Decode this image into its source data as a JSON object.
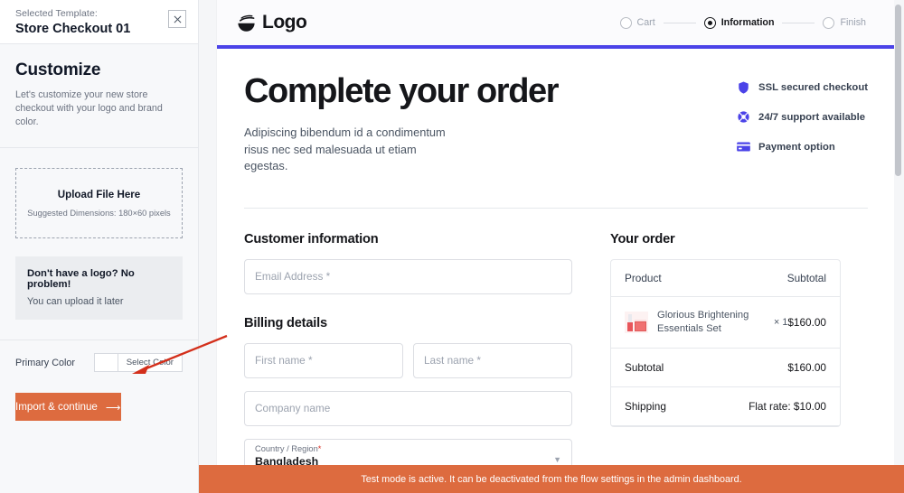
{
  "sidebar": {
    "selected_template_label": "Selected Template:",
    "template_name": "Store Checkout 01",
    "close_icon": "close-icon",
    "customize_title": "Customize",
    "customize_desc": "Let's customize your new store checkout with your logo and brand color.",
    "upload": {
      "title": "Upload File Here",
      "subtitle": "Suggested Dimensions: 180×60 pixels"
    },
    "no_logo": {
      "title": "Don't have a logo? No problem!",
      "subtitle": "You can upload it later"
    },
    "primary_color_label": "Primary Color",
    "select_color_label": "Select Color",
    "swatch_color": "#ffffff",
    "import_button": "Import & continue",
    "import_button_arrow": "⟶",
    "accent_color": "#dd6b3f"
  },
  "checkout": {
    "logo_text": "Logo",
    "brand_color": "#4b43e8",
    "steps": [
      {
        "label": "Cart",
        "active": false
      },
      {
        "label": "Information",
        "active": true
      },
      {
        "label": "Finish",
        "active": false
      }
    ],
    "hero": {
      "title": "Complete your order",
      "subtitle": "Adipiscing bibendum id a condimentum risus nec sed malesuada ut etiam egestas."
    },
    "trust": [
      {
        "icon": "shield-icon",
        "label": "SSL secured checkout"
      },
      {
        "icon": "lifebuoy-icon",
        "label": "24/7 support available"
      },
      {
        "icon": "credit-card-icon",
        "label": "Payment option"
      }
    ],
    "customer_information": {
      "heading": "Customer information",
      "email_placeholder": "Email Address *"
    },
    "billing_details": {
      "heading": "Billing details",
      "first_name_placeholder": "First name *",
      "last_name_placeholder": "Last name *",
      "company_placeholder": "Company name",
      "country_label": "Country / Region",
      "country_required": "*",
      "country_value": "Bangladesh",
      "caret_icon": "chevron-down-icon"
    },
    "order": {
      "heading": "Your order",
      "col_product": "Product",
      "col_subtotal": "Subtotal",
      "items": [
        {
          "name": "Glorious Brightening Essentials Set",
          "qty": "× 1",
          "price": "$160.00"
        }
      ],
      "rows": [
        {
          "label": "Subtotal",
          "value": "$160.00"
        },
        {
          "label": "Shipping",
          "value": "Flat rate: $10.00"
        }
      ]
    }
  },
  "banner": {
    "text": "Test mode is active. It can be deactivated from the flow settings in the admin dashboard.",
    "color": "#dd6b3f"
  }
}
